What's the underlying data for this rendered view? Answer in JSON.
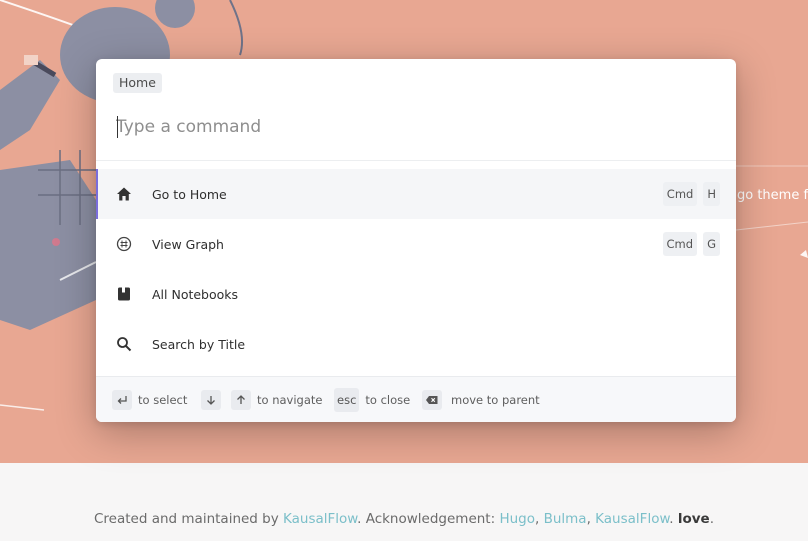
{
  "hero": {
    "tagline_fragment": "go theme f"
  },
  "palette": {
    "breadcrumb": "Home",
    "input": {
      "placeholder": "Type a command",
      "value": ""
    },
    "results": [
      {
        "label": "Go to Home",
        "icon": "home-icon",
        "keys": [
          "Cmd",
          "H"
        ],
        "active": true
      },
      {
        "label": "View Graph",
        "icon": "graph-icon",
        "keys": [
          "Cmd",
          "G"
        ],
        "active": false
      },
      {
        "label": "All Notebooks",
        "icon": "notebook-icon",
        "keys": [],
        "active": false
      },
      {
        "label": "Search by Title",
        "icon": "search-icon",
        "keys": [],
        "active": false
      }
    ],
    "hints": {
      "select": "to select",
      "navigate": "to navigate",
      "close_key": "esc",
      "close": "to close",
      "parent": "move to parent"
    }
  },
  "footer": {
    "prefix": "Created and maintained by ",
    "author_link": "KausalFlow",
    "ack": ". Acknowledgement: ",
    "link_hugo": "Hugo",
    "sep1": ", ",
    "link_bulma": "Bulma",
    "sep2": ", ",
    "link_kausal": "KausalFlow",
    "sep3": ". ",
    "love": "love",
    "end": "."
  },
  "colors": {
    "hero_bg": "#e8a792",
    "accent": "#7a6ddb",
    "link": "#7bbfc9"
  }
}
